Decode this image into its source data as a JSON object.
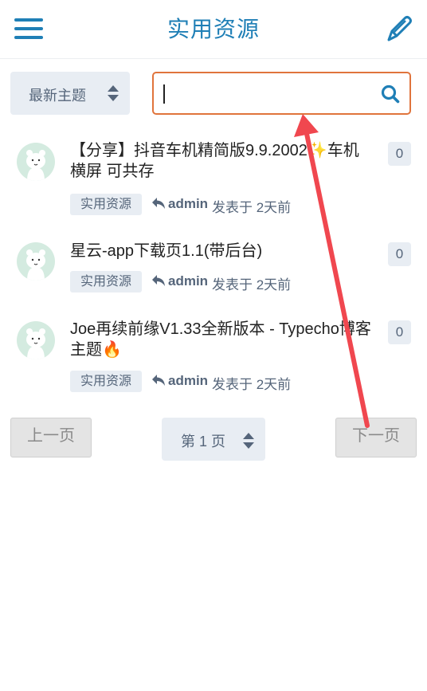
{
  "header": {
    "title": "实用资源",
    "menu_icon": "hamburger-menu-icon",
    "edit_icon": "pencil-icon"
  },
  "colors": {
    "brand": "#1f7fb6",
    "search_border": "#e0743c",
    "chip_bg": "#e8edf3",
    "chip_text": "#55657a",
    "annotation_arrow": "#f0474f"
  },
  "filter": {
    "sort_label": "最新主题",
    "search_placeholder": "",
    "search_value": ""
  },
  "posts": [
    {
      "title_parts": [
        "【分享】抖音车机精简版9.9.2002",
        "✨",
        "车机横屏 可共存"
      ],
      "tag": "实用资源",
      "author": "admin",
      "posted": "发表于 2天前",
      "comments": "0"
    },
    {
      "title": "星云-app下载页1.1(带后台)",
      "tag": "实用资源",
      "author": "admin",
      "posted": "发表于 2天前",
      "comments": "0"
    },
    {
      "title_parts": [
        "Joe再续前缘V1.33全新版本 - Typecho博客主题",
        "🔥"
      ],
      "tag": "实用资源",
      "author": "admin",
      "posted": "发表于 2天前",
      "comments": "0"
    }
  ],
  "pagination": {
    "prev": "上一页",
    "page": "第 1 页",
    "next": "下一页"
  }
}
